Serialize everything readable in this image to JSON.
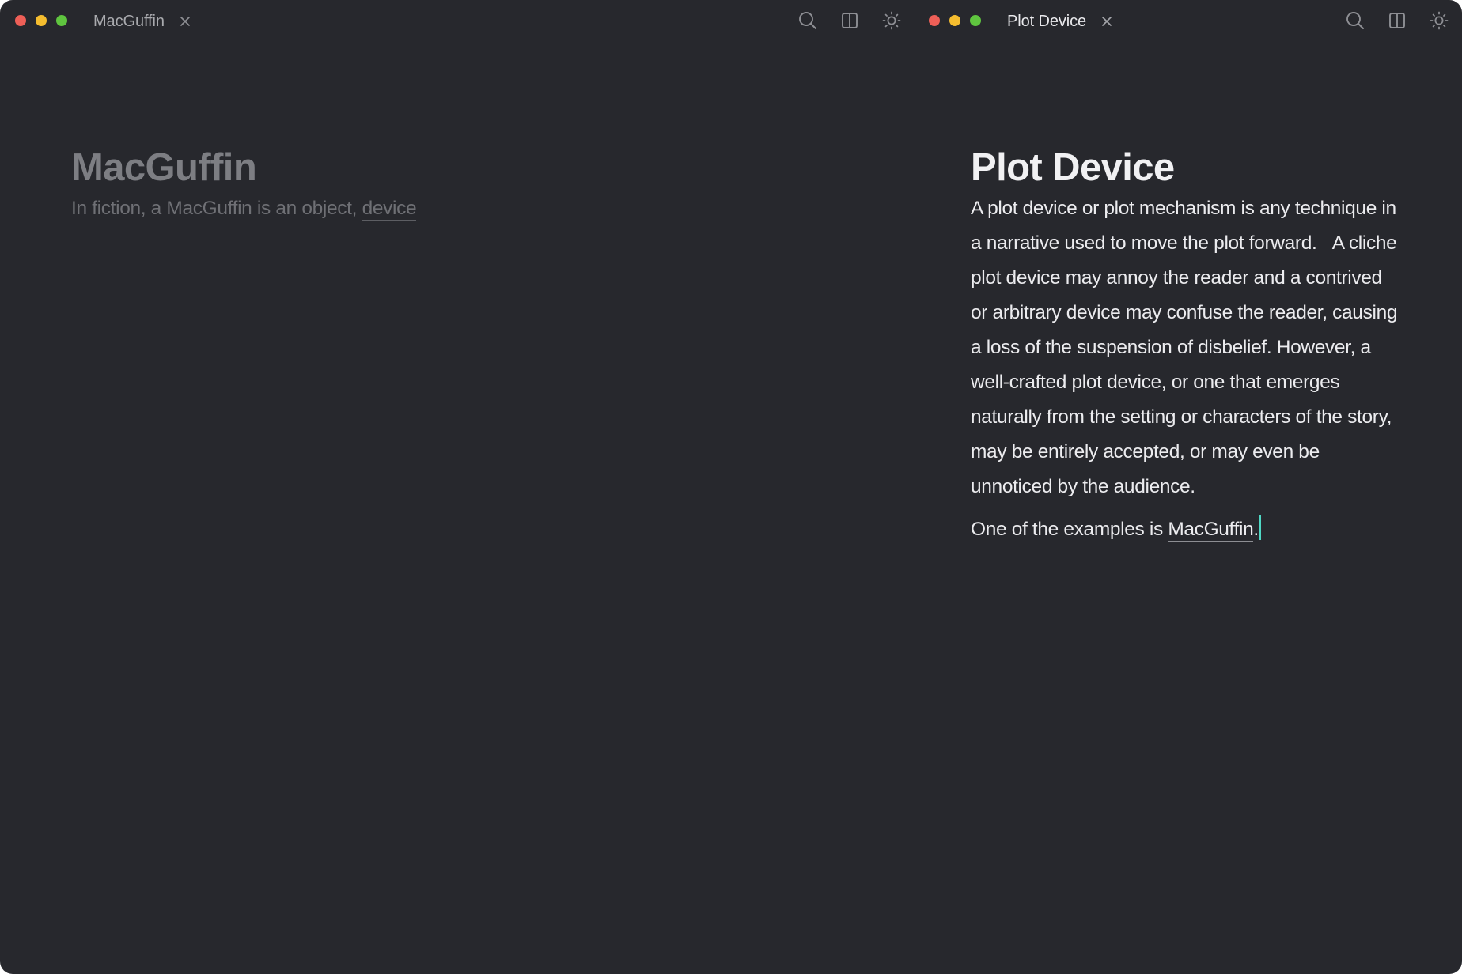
{
  "windows": [
    {
      "tab_title": "MacGuffin",
      "toolbar": {
        "search_icon": "search-icon",
        "split_icon": "split-view-icon",
        "theme_icon": "sun-icon"
      },
      "document": {
        "title": "MacGuffin",
        "paragraph_text": "In fiction, a MacGuffin is an object, ",
        "paragraph_link": "device"
      }
    },
    {
      "tab_title": "Plot Device",
      "toolbar": {
        "search_icon": "search-icon",
        "split_icon": "split-view-icon",
        "theme_icon": "sun-icon"
      },
      "document": {
        "title": "Plot Device",
        "paragraph_1": "A plot device or plot mechanism is any technique in a narrative used to move the plot forward.   A cliche plot device may annoy the reader and a contrived or arbitrary device may confuse the reader, causing a loss of the suspension of disbelief. However, a well-crafted plot device, or one that emerges naturally from the setting or characters of the story, may be entirely accepted, or may even be unnoticed by the audience.",
        "paragraph_2_text": "One of the examples is ",
        "paragraph_2_link": "MacGuffin",
        "paragraph_2_end": "."
      }
    }
  ],
  "colors": {
    "background": "#27282d",
    "traffic_close": "#ee5f57",
    "traffic_minimize": "#f5bd2f",
    "traffic_maximize": "#5fc53f",
    "caret": "#4fd8c4"
  }
}
